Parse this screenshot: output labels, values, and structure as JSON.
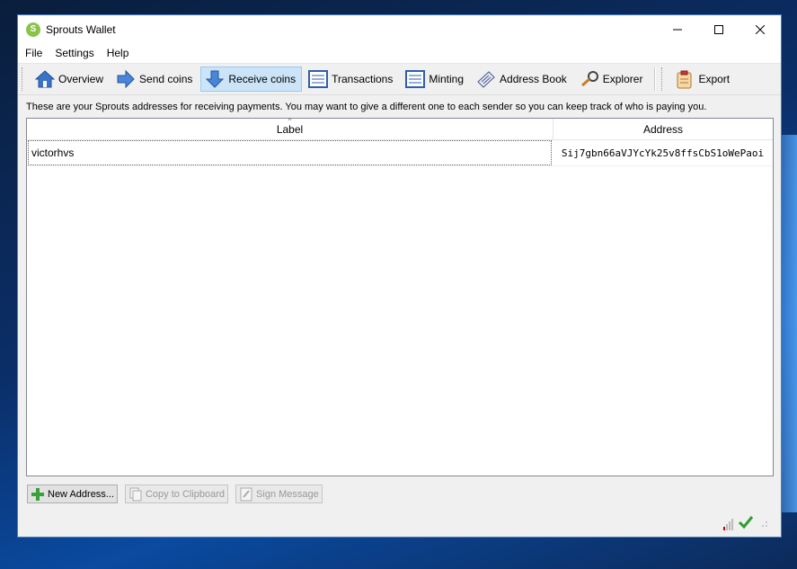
{
  "window": {
    "title": "Sprouts Wallet",
    "minimize_icon": "minimize-icon",
    "maximize_icon": "maximize-icon",
    "close_icon": "close-icon"
  },
  "menu": {
    "items": [
      {
        "label": "File"
      },
      {
        "label": "Settings"
      },
      {
        "label": "Help"
      }
    ]
  },
  "toolbar": {
    "items": [
      {
        "label": "Overview",
        "icon": "home-icon"
      },
      {
        "label": "Send coins",
        "icon": "arrow-right-icon"
      },
      {
        "label": "Receive coins",
        "icon": "arrow-down-icon",
        "active": true
      },
      {
        "label": "Transactions",
        "icon": "list-icon"
      },
      {
        "label": "Minting",
        "icon": "list-icon"
      },
      {
        "label": "Address Book",
        "icon": "address-book-icon"
      },
      {
        "label": "Explorer",
        "icon": "key-search-icon"
      }
    ],
    "export": {
      "label": "Export",
      "icon": "clipboard-icon"
    }
  },
  "main": {
    "info_text": "These are your Sprouts addresses for receiving payments.  You may want to give a different one to each sender so you can keep track of who is paying you.",
    "columns": {
      "label": "Label",
      "address": "Address"
    },
    "rows": [
      {
        "label": "victorhvs",
        "address": "Sij7gbn66aVJYcYk25v8ffsCbS1oWePaoi"
      }
    ]
  },
  "buttons": {
    "new_address": "New Address...",
    "copy_clipboard": "Copy to Clipboard",
    "sign_message": "Sign Message"
  },
  "colors": {
    "accent": "#cce4f7",
    "brand": "#8bc34a",
    "check": "#2e9e2e"
  }
}
